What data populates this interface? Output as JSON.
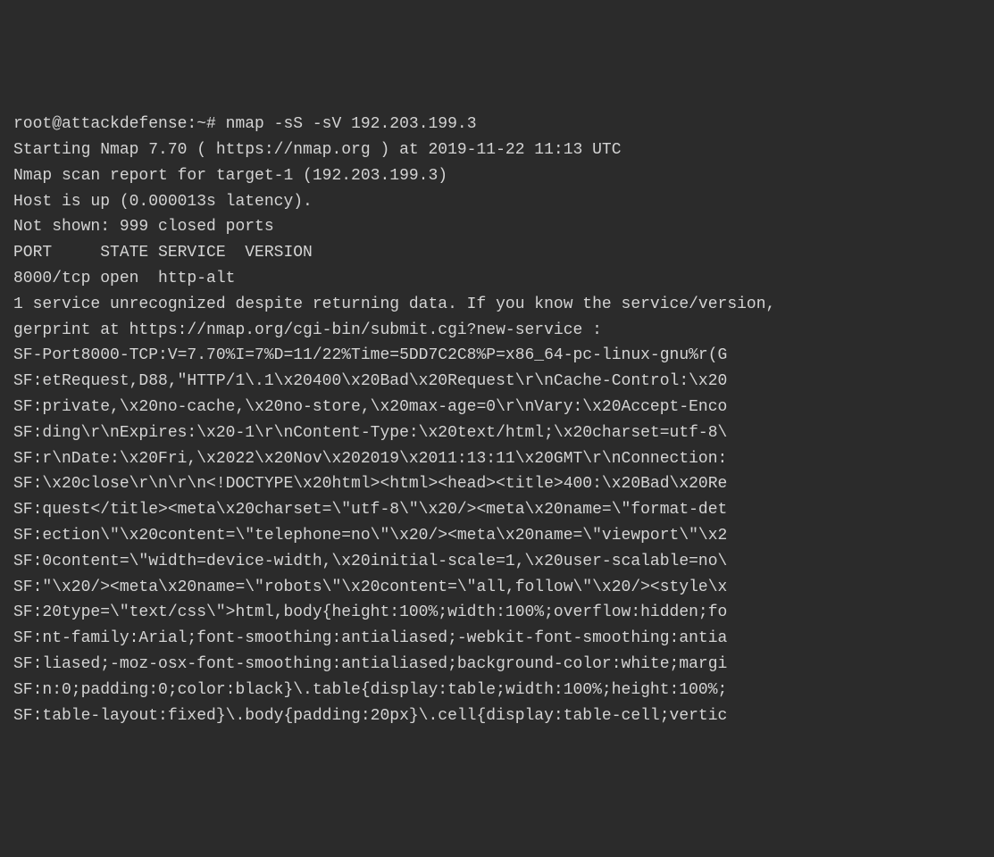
{
  "terminal": {
    "prompt": "root@attackdefense:~#",
    "command": "nmap -sS -sV 192.203.199.3",
    "lines": [
      "Starting Nmap 7.70 ( https://nmap.org ) at 2019-11-22 11:13 UTC",
      "Nmap scan report for target-1 (192.203.199.3)",
      "Host is up (0.000013s latency).",
      "Not shown: 999 closed ports",
      "PORT     STATE SERVICE  VERSION",
      "8000/tcp open  http-alt",
      "1 service unrecognized despite returning data. If you know the service/version,",
      "gerprint at https://nmap.org/cgi-bin/submit.cgi?new-service :",
      "SF-Port8000-TCP:V=7.70%I=7%D=11/22%Time=5DD7C2C8%P=x86_64-pc-linux-gnu%r(G",
      "SF:etRequest,D88,\"HTTP/1\\.1\\x20400\\x20Bad\\x20Request\\r\\nCache-Control:\\x20",
      "SF:private,\\x20no-cache,\\x20no-store,\\x20max-age=0\\r\\nVary:\\x20Accept-Enco",
      "SF:ding\\r\\nExpires:\\x20-1\\r\\nContent-Type:\\x20text/html;\\x20charset=utf-8\\",
      "SF:r\\nDate:\\x20Fri,\\x2022\\x20Nov\\x202019\\x2011:13:11\\x20GMT\\r\\nConnection:",
      "SF:\\x20close\\r\\n\\r\\n<!DOCTYPE\\x20html><html><head><title>400:\\x20Bad\\x20Re",
      "SF:quest</title><meta\\x20charset=\\\"utf-8\\\"\\x20/><meta\\x20name=\\\"format-det",
      "SF:ection\\\"\\x20content=\\\"telephone=no\\\"\\x20/><meta\\x20name=\\\"viewport\\\"\\x2",
      "SF:0content=\\\"width=device-width,\\x20initial-scale=1,\\x20user-scalable=no\\",
      "SF:\"\\x20/><meta\\x20name=\\\"robots\\\"\\x20content=\\\"all,follow\\\"\\x20/><style\\x",
      "SF:20type=\\\"text/css\\\">html,body{height:100%;width:100%;overflow:hidden;fo",
      "SF:nt-family:Arial;font-smoothing:antialiased;-webkit-font-smoothing:antia",
      "SF:liased;-moz-osx-font-smoothing:antialiased;background-color:white;margi",
      "SF:n:0;padding:0;color:black}\\.table{display:table;width:100%;height:100%;",
      "SF:table-layout:fixed}\\.body{padding:20px}\\.cell{display:table-cell;vertic"
    ]
  }
}
